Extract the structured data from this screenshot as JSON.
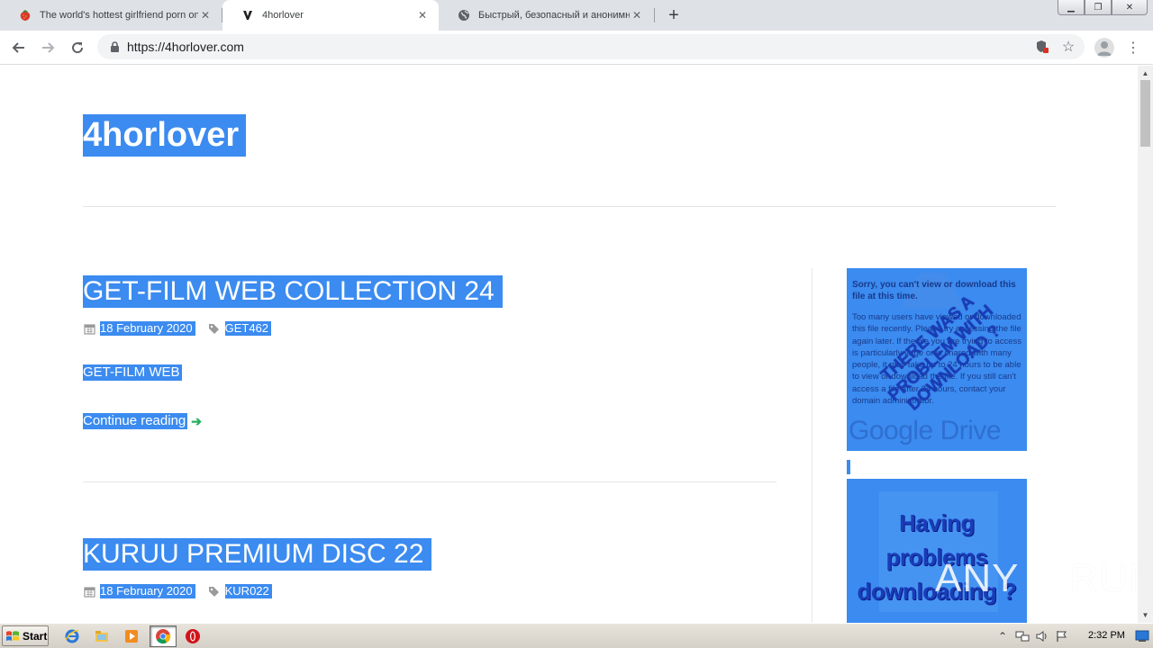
{
  "browser": {
    "tabs": [
      {
        "title": "The world's hottest girlfriend porn on",
        "favicon": "strawberry-icon",
        "active": false
      },
      {
        "title": "4horlover",
        "favicon": "site-logo-icon",
        "active": true
      },
      {
        "title": "Быстрый, безопасный и анонимный",
        "favicon": "globe-icon",
        "active": false
      }
    ],
    "new_tab_icon": "plus-icon",
    "address": "https://4horlover.com",
    "window_controls": [
      "minimize-icon",
      "restore-icon",
      "close-icon"
    ]
  },
  "page": {
    "site_title": "4horlover",
    "highlight_color": "#3b8bf0",
    "accent_color": "#27ae60",
    "posts": [
      {
        "title": "GET-FILM WEB COLLECTION 24",
        "date": "18 February 2020",
        "tag": "GET462",
        "excerpt": "GET-FILM WEB",
        "more_label": "Continue reading"
      },
      {
        "title": "KURUU PREMIUM DISC 22",
        "date": "18 February 2020",
        "tag": "KUR022"
      }
    ],
    "sidebar": {
      "drive_image": {
        "heading": "Sorry, you can't view or download this file at this time.",
        "body": "Too many users have viewed or downloaded this file recently. Please try accessing the file again later. If the file you are trying to access is particularly large or is shared with many people, it may take up to 24 hours to be able to view or download the file. If you still can't access a file after 24 hours, contact your domain administrator.",
        "stamp": "THERE WAS A PROBLEM WITH DOWNLOAD ?",
        "logo": "Google Drive"
      },
      "problems_image": {
        "text": "Having problems downloading ?"
      }
    },
    "watermark": {
      "left": "ANY",
      "right": "RUN"
    }
  },
  "taskbar": {
    "start_label": "Start",
    "clock": "2:32 PM",
    "apps": [
      "ie-icon",
      "explorer-icon",
      "media-player-icon",
      "chrome-icon",
      "opera-icon"
    ]
  }
}
